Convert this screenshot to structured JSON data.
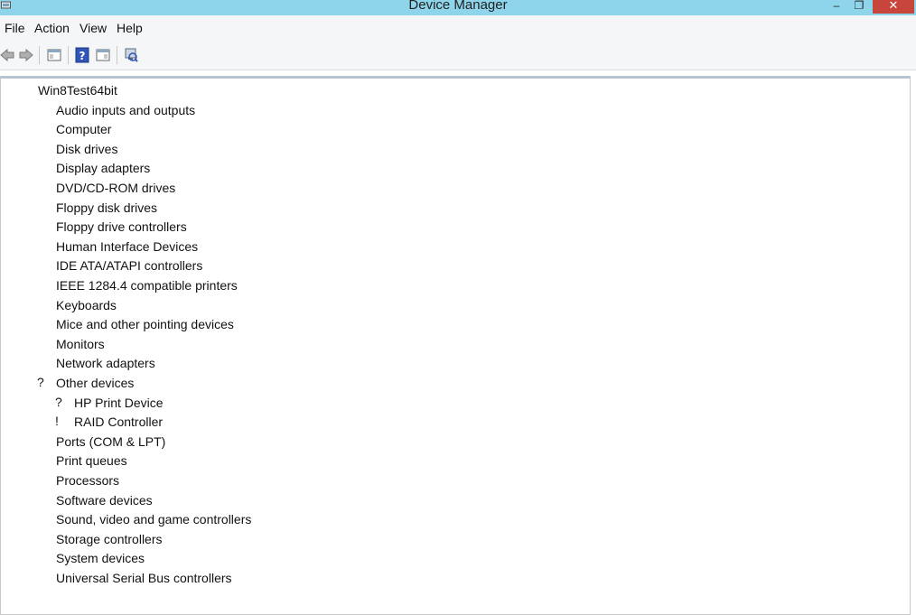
{
  "window": {
    "title": "Device Manager",
    "min_glyph": "‒",
    "max_glyph": "❐",
    "close_glyph": "✕"
  },
  "menu": [
    "File",
    "Action",
    "View",
    "Help"
  ],
  "toolbar": {
    "buttons": [
      "back-icon",
      "forward-icon",
      "properties-icon",
      "help-icon",
      "show-hide-console-tree-icon",
      "scan-hardware-icon"
    ]
  },
  "tree": {
    "root": "Win8Test64bit",
    "categories": [
      {
        "label": "Audio inputs and outputs",
        "icon": "speaker-icon"
      },
      {
        "label": "Computer",
        "icon": "computer-icon"
      },
      {
        "label": "Disk drives",
        "icon": "disk-drive-icon"
      },
      {
        "label": "Display adapters",
        "icon": "display-adapter-icon"
      },
      {
        "label": "DVD/CD-ROM drives",
        "icon": "dvd-drive-icon"
      },
      {
        "label": "Floppy disk drives",
        "icon": "floppy-drive-icon"
      },
      {
        "label": "Floppy drive controllers",
        "icon": "floppy-controller-icon"
      },
      {
        "label": "Human Interface Devices",
        "icon": "hid-icon"
      },
      {
        "label": "IDE ATA/ATAPI controllers",
        "icon": "ide-controller-icon"
      },
      {
        "label": "IEEE 1284.4 compatible printers",
        "icon": "printer-icon"
      },
      {
        "label": "Keyboards",
        "icon": "keyboard-icon"
      },
      {
        "label": "Mice and other pointing devices",
        "icon": "mouse-icon"
      },
      {
        "label": "Monitors",
        "icon": "monitor-icon"
      },
      {
        "label": "Network adapters",
        "icon": "network-adapter-icon"
      },
      {
        "label": "Other devices",
        "icon": "unknown-device-icon",
        "expanded": true
      },
      {
        "label": "HP Print Device",
        "icon": "unknown-device-icon",
        "child": true
      },
      {
        "label": "RAID Controller",
        "icon": "warning-device-icon",
        "child": true
      },
      {
        "label": "Ports (COM & LPT)",
        "icon": "port-icon"
      },
      {
        "label": "Print queues",
        "icon": "print-queue-icon"
      },
      {
        "label": "Processors",
        "icon": "processor-icon"
      },
      {
        "label": "Software devices",
        "icon": "software-device-icon"
      },
      {
        "label": "Sound, video and game controllers",
        "icon": "sound-controller-icon"
      },
      {
        "label": "Storage controllers",
        "icon": "storage-controller-icon"
      },
      {
        "label": "System devices",
        "icon": "system-device-icon"
      },
      {
        "label": "Universal Serial Bus controllers",
        "icon": "usb-icon"
      }
    ]
  },
  "colors": {
    "titlebar": "#8ed4ea",
    "close_button": "#c7453b",
    "warning": "#f2c200"
  }
}
